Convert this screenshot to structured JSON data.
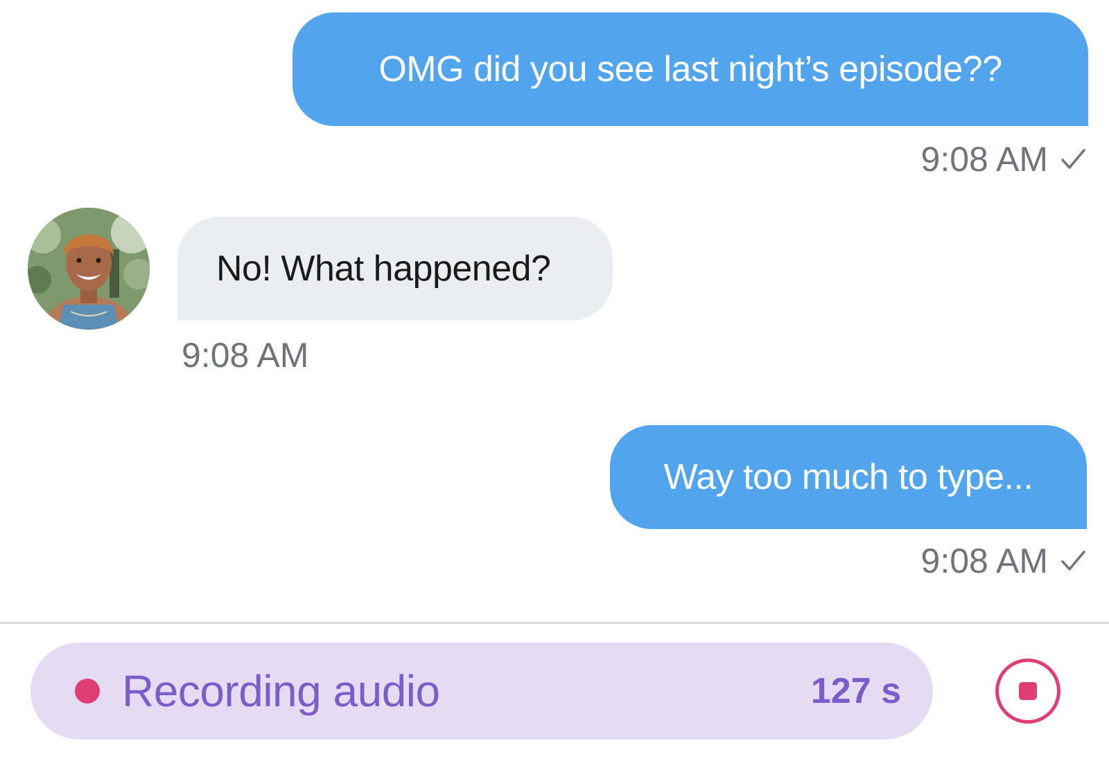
{
  "messages": [
    {
      "direction": "outgoing",
      "text": "OMG did you see last night’s episode??",
      "time": "9:08 AM",
      "status_icon": "checkmark-icon"
    },
    {
      "direction": "incoming",
      "text": "No! What happened?",
      "time": "9:08 AM",
      "avatar": "contact-avatar"
    },
    {
      "direction": "outgoing",
      "text": "Way too much to type...",
      "time": "9:08 AM",
      "status_icon": "checkmark-icon"
    }
  ],
  "recorder": {
    "label": "Recording audio",
    "count": "127 s",
    "stop_icon": "stop-icon"
  },
  "colors": {
    "outgoing_bubble": "#52a5ec",
    "incoming_bubble": "#ebeef1",
    "timestamp": "#6e7479",
    "recorder_background": "#e4dcf2",
    "recorder_text": "#7b5cc9",
    "recording_accent": "#de3e74"
  }
}
